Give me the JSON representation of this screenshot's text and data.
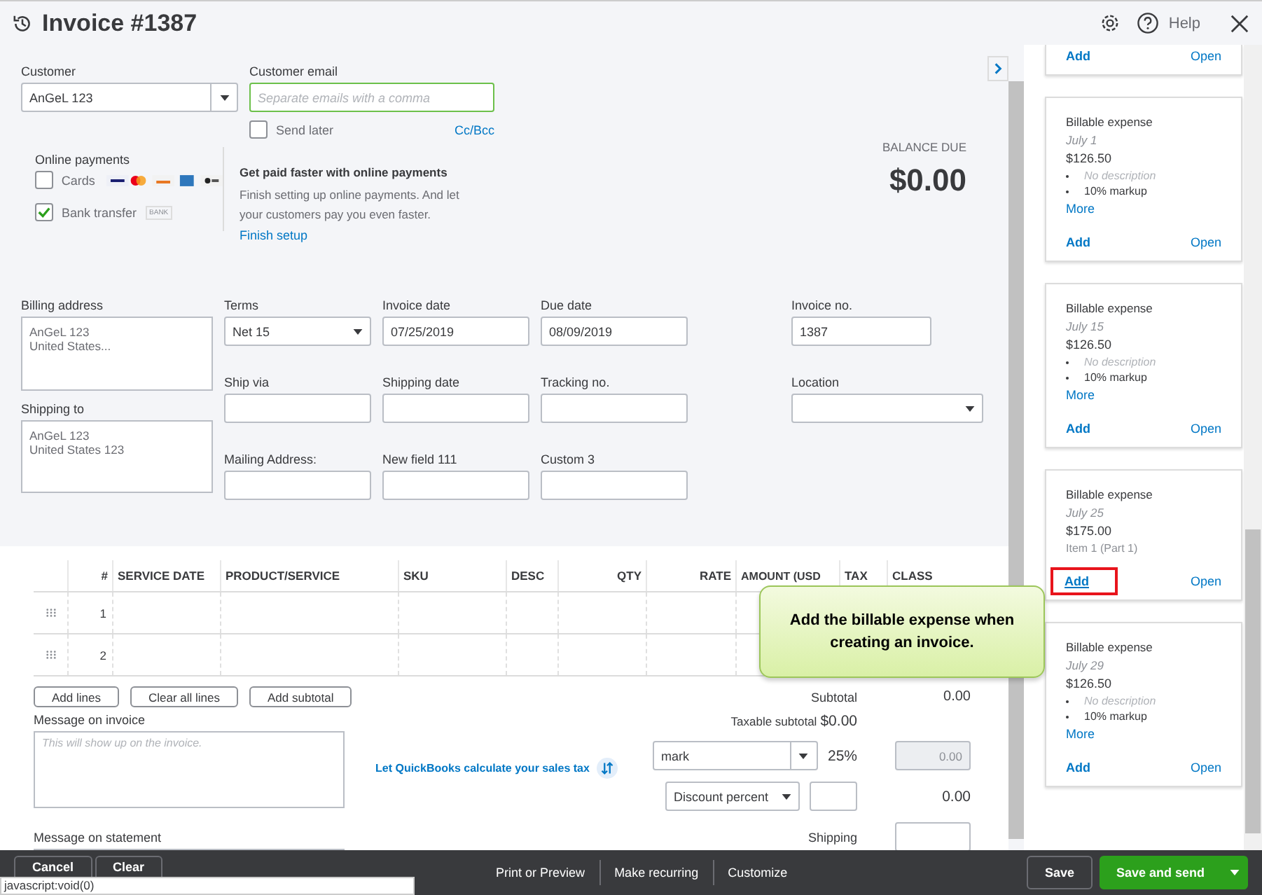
{
  "header": {
    "title": "Invoice #1387",
    "help": "Help"
  },
  "customer": {
    "label": "Customer",
    "value": "AnGeL 123"
  },
  "email": {
    "label": "Customer email",
    "placeholder": "Separate emails with a comma",
    "send_later": {
      "label": "Send later",
      "checked": false
    },
    "cc_bcc": "Cc/Bcc"
  },
  "online_payments": {
    "title": "Online payments",
    "options": [
      {
        "label": "Cards",
        "checked": false,
        "kind": "cards"
      },
      {
        "label": "Bank transfer",
        "checked": true,
        "kind": "bank",
        "badge": "BANK"
      }
    ]
  },
  "promo": {
    "title": "Get paid faster with online payments",
    "body": "Finish setting up online payments. And let your customers pay you even faster.",
    "link": "Finish setup"
  },
  "balance": {
    "label": "BALANCE DUE",
    "amount": "$0.00"
  },
  "addresses": [
    {
      "label": "Billing address",
      "lines": [
        "AnGeL 123",
        "United States..."
      ]
    },
    {
      "label": "Shipping to",
      "lines": [
        "AnGeL 123",
        "United States 123"
      ]
    }
  ],
  "fields": [
    {
      "label": "Terms",
      "value": "Net 15",
      "kind": "select"
    },
    {
      "label": "Invoice date",
      "value": "07/25/2019",
      "kind": "text"
    },
    {
      "label": "Due date",
      "value": "08/09/2019",
      "kind": "text"
    },
    {
      "label": "Ship via",
      "kind": "text"
    },
    {
      "label": "Shipping date",
      "kind": "text"
    },
    {
      "label": "Tracking no.",
      "kind": "text"
    },
    {
      "label": "Mailing Address:",
      "kind": "text"
    },
    {
      "label": "New field 111",
      "kind": "text"
    },
    {
      "label": "Custom 3",
      "kind": "text"
    }
  ],
  "side_fields": [
    {
      "label": "Invoice no.",
      "value": "1387",
      "kind": "text"
    },
    {
      "label": "Location",
      "kind": "select"
    }
  ],
  "table": {
    "columns": [
      "#",
      "SERVICE DATE",
      "PRODUCT/SERVICE",
      "SKU",
      "DESC",
      "QTY",
      "RATE",
      "AMOUNT (USD",
      "TAX",
      "CLASS"
    ],
    "rows": [
      {
        "number": "1"
      },
      {
        "number": "2"
      }
    ]
  },
  "line_buttons": [
    "Add lines",
    "Clear all lines",
    "Add subtotal"
  ],
  "message_invoice": {
    "label": "Message on invoice",
    "placeholder": "This will show up on the invoice."
  },
  "message_statement": {
    "label": "Message on statement"
  },
  "tax_link": "Let QuickBooks calculate your sales tax",
  "totals": {
    "subtotal_label": "Subtotal",
    "subtotal": "0.00",
    "taxable_label": "Taxable subtotal",
    "taxable": "$0.00",
    "tax_select": "mark",
    "tax_rate": "25%",
    "tax_amount": "0.00",
    "discount_select": "Discount percent",
    "discount_amount": "0.00",
    "shipping_label": "Shipping"
  },
  "expenses": [
    {
      "kind": "cut",
      "add": "Add",
      "open": "Open",
      "highlighted": false
    },
    {
      "kind": "full",
      "title": "Billable expense",
      "date": "July 1",
      "amount": "$126.50",
      "bullets": [
        "No description",
        "10% markup"
      ],
      "more": "More",
      "add": "Add",
      "open": "Open",
      "highlighted": false
    },
    {
      "kind": "full",
      "title": "Billable expense",
      "date": "July 15",
      "amount": "$126.50",
      "bullets": [
        "No description",
        "10% markup"
      ],
      "more": "More",
      "add": "Add",
      "open": "Open",
      "highlighted": false
    },
    {
      "kind": "full",
      "title": "Billable expense",
      "date": "July 25",
      "amount": "$175.00",
      "note": "Item 1 (Part 1)",
      "add": "Add",
      "open": "Open",
      "highlighted": true
    },
    {
      "kind": "full",
      "title": "Billable expense",
      "date": "July 29",
      "amount": "$126.50",
      "bullets": [
        "No description",
        "10% markup"
      ],
      "more": "More",
      "add": "Add",
      "open": "Open",
      "highlighted": false
    }
  ],
  "callout": "Add the billable expense when creating an invoice.",
  "footer": {
    "left": [
      "Cancel",
      "Clear"
    ],
    "center": [
      "Print or Preview",
      "Make recurring",
      "Customize"
    ],
    "save": "Save",
    "save_send": "Save and send"
  },
  "status_url": "javascript:void(0)"
}
